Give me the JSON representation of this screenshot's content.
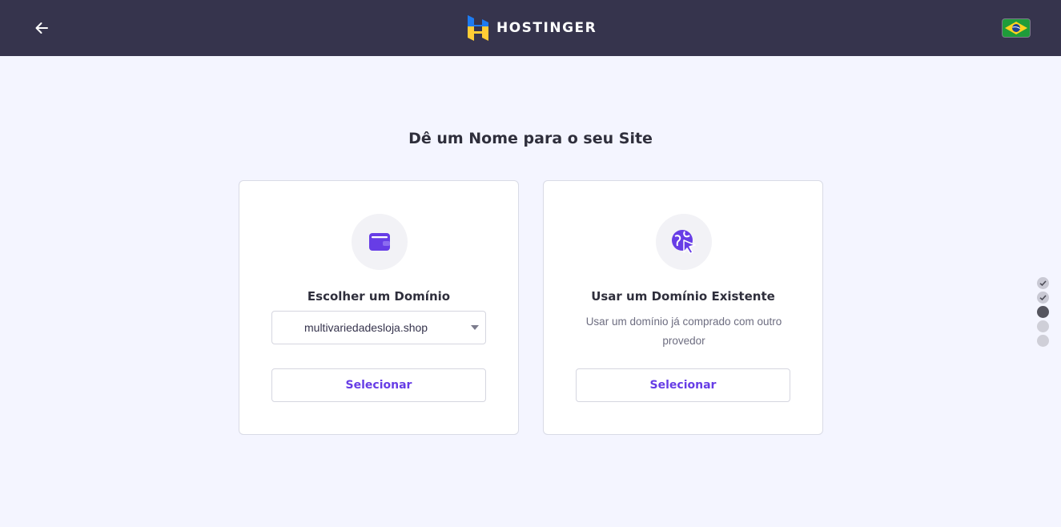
{
  "header": {
    "logo_text": "HOSTINGER",
    "language": "brazil-flag",
    "colors": {
      "bar": "#36344d",
      "logo_blue": "#1e7bf0",
      "logo_yellow": "#ffcd35"
    }
  },
  "main": {
    "title": "Dê um Nome para o seu Site"
  },
  "cards": [
    {
      "icon": "wallet-icon",
      "title": "Escolher um Domínio",
      "domain_select_value": "multivariedadesloja.shop",
      "button_label": "Selecionar"
    },
    {
      "icon": "globe-cursor-icon",
      "title": "Usar um Domínio Existente",
      "description": "Usar um domínio já comprado com outro provedor",
      "button_label": "Selecionar"
    }
  ],
  "stepper": {
    "steps": [
      "done",
      "done",
      "current",
      "todo",
      "todo"
    ]
  },
  "accent_color": "#673de6",
  "annotation_color": "#22e022"
}
